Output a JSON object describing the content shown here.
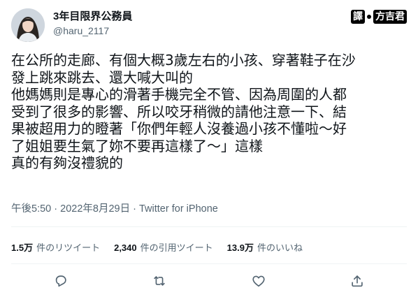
{
  "tweet": {
    "author": {
      "display_name": "3年目限界公務員",
      "handle": "@haru_2117"
    },
    "translator_stamp": {
      "left": "譯",
      "right": "方吉君"
    },
    "lines": [
      "在公所的走廊、有個大概3歲左右的小孩、穿著鞋子在沙",
      "發上跳來跳去、還大喊大叫的",
      "他媽媽則是專心的滑著手機完全不管、因為周圍的人都",
      "受到了很多的影響、所以咬牙稍微的請他注意一下、結",
      "果被超用力的瞪著「你們年輕人沒養過小孩不懂啦～好",
      "了姐姐要生氣了妳不要再這樣了～」這樣",
      "真的有夠沒禮貌的"
    ],
    "time": "午後5:50",
    "date": "2022年8月29日",
    "separator": "·",
    "source": "Twitter for iPhone",
    "stats": [
      {
        "value": "1.5万",
        "label": "件のリツイート"
      },
      {
        "value": "2,340",
        "label": "件の引用ツイート"
      },
      {
        "value": "13.9万",
        "label": "件のいいね"
      }
    ],
    "actions": [
      "reply-icon",
      "retweet-icon",
      "like-icon",
      "share-icon"
    ],
    "colors": {
      "text": "#0f1419",
      "secondary": "#536471",
      "divider": "#eff3f4"
    }
  }
}
